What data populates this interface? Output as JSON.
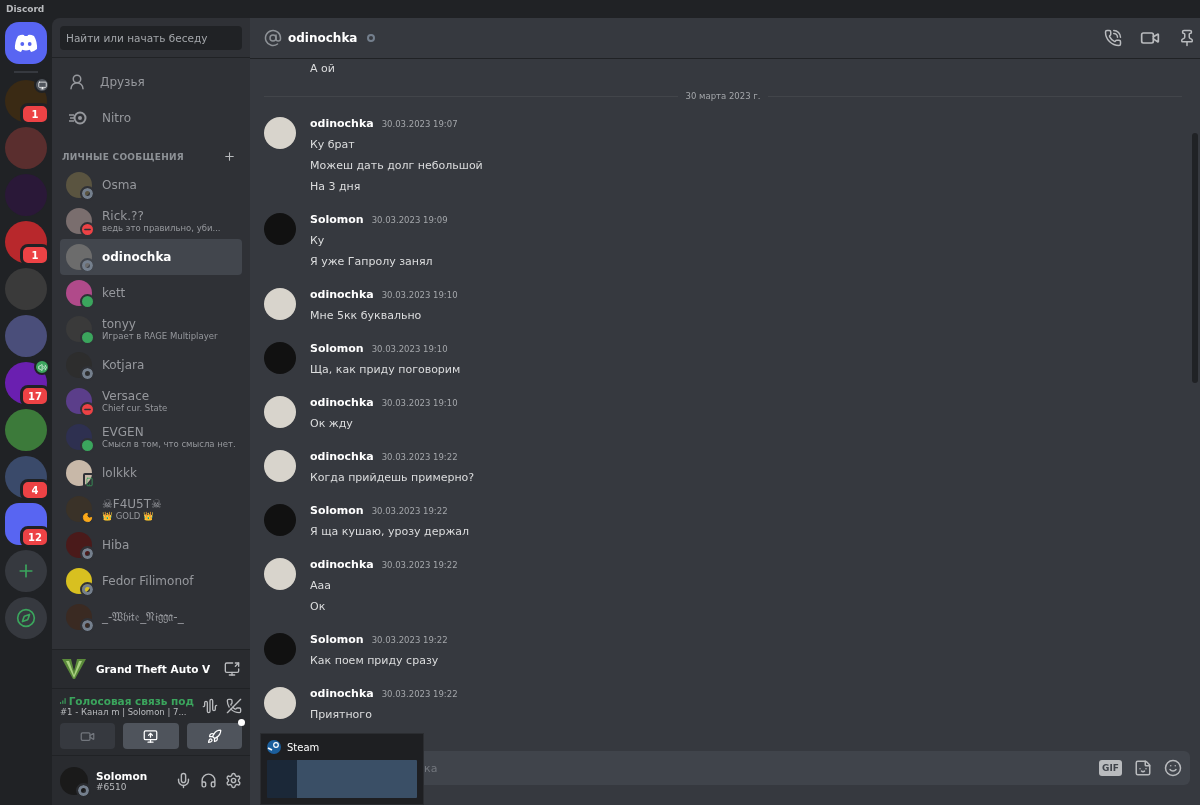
{
  "app_title": "Discord",
  "servers": [
    {
      "kind": "screen",
      "color": "#3a2a14",
      "badge": "1"
    },
    {
      "kind": "plain",
      "color": "#5a2e2e"
    },
    {
      "kind": "plain",
      "color": "#2a1838"
    },
    {
      "kind": "plain",
      "color": "#b8282c",
      "badge": "1"
    },
    {
      "kind": "plain",
      "color": "#3a3a3a"
    },
    {
      "kind": "plain",
      "color": "#4a4e7a"
    },
    {
      "kind": "speaker",
      "color": "#6a1fb0",
      "badge": "17"
    },
    {
      "kind": "plain",
      "color": "#3c7a3a"
    },
    {
      "kind": "plain",
      "color": "#3a4a6a",
      "badge": "4"
    },
    {
      "kind": "plain",
      "color": "#5865f2",
      "badge": "12"
    }
  ],
  "search": {
    "placeholder": "Найти или начать беседу"
  },
  "nav": [
    {
      "kind": "friends",
      "label": "Друзья"
    },
    {
      "kind": "nitro",
      "label": "Nitro"
    }
  ],
  "dm_header": "ЛИЧНЫЕ СООБЩЕНИЯ",
  "dms": [
    {
      "kind": "offline",
      "name": "Osma",
      "selected": false
    },
    {
      "kind": "dnd",
      "name": "Rick.??",
      "subtitle": "ведь это правильно, уби...",
      "selected": false
    },
    {
      "kind": "offline",
      "name": "odinochka",
      "selected": true
    },
    {
      "kind": "online",
      "name": "kett",
      "selected": false
    },
    {
      "kind": "online",
      "name": "tonyy",
      "subtitle": "Играет в RAGE Multiplayer",
      "selected": false
    },
    {
      "kind": "offline",
      "name": "Kotjara",
      "selected": false
    },
    {
      "kind": "dnd",
      "name": "Versace",
      "subtitle": "Chief cur. State",
      "selected": false
    },
    {
      "kind": "online",
      "name": "EVGEN",
      "subtitle": "Смысл в том, что смысла нет.",
      "selected": false
    },
    {
      "kind": "mobile",
      "name": "lolkkk",
      "selected": false
    },
    {
      "kind": "idle",
      "name": "☠F4U5T☠",
      "subtitle": "👑 GOLD 👑",
      "selected": false
    },
    {
      "kind": "offline",
      "name": "Hiba",
      "selected": false
    },
    {
      "kind": "offline",
      "name": "Fedor Filimonof",
      "selected": false
    },
    {
      "kind": "offline",
      "name": "_-𝔚𝔥𝔦𝔱𝔢_𝔑𝔦𝔤𝔤𝔞-_",
      "selected": false
    }
  ],
  "activity": {
    "game": "Grand Theft Auto V"
  },
  "voice": {
    "status": "Голосовая связь под",
    "channel": "#1 - Канал m | Solomon | 7..."
  },
  "user": {
    "name": "Solomon",
    "tag": "#6510"
  },
  "chat_header": {
    "name": "odinochka"
  },
  "messages": [
    {
      "lines": [
        "А ой"
      ]
    },
    {
      "kind": "divider",
      "label": "30 марта 2023 г."
    },
    {
      "author": "odinochka",
      "time": "30.03.2023 19:07",
      "lines": [
        "Ку брат",
        "Можеш дать долг небольшой",
        "На 3 дня"
      ]
    },
    {
      "author": "Solomon",
      "time": "30.03.2023 19:09",
      "lines": [
        "Ку",
        "Я уже Гапролу занял"
      ]
    },
    {
      "author": "odinochka",
      "time": "30.03.2023 19:10",
      "lines": [
        "Мне 5кк буквально"
      ]
    },
    {
      "author": "Solomon",
      "time": "30.03.2023 19:10",
      "lines": [
        "Ща, как приду поговорим"
      ]
    },
    {
      "author": "odinochka",
      "time": "30.03.2023 19:10",
      "lines": [
        "Ок жду"
      ]
    },
    {
      "author": "odinochka",
      "time": "30.03.2023 19:22",
      "lines": [
        "Когда прийдешь примерно?"
      ]
    },
    {
      "author": "Solomon",
      "time": "30.03.2023 19:22",
      "lines": [
        "Я ща кушаю, урозу держал"
      ]
    },
    {
      "author": "odinochka",
      "time": "30.03.2023 19:22",
      "lines": [
        "Ааа",
        "Ок"
      ]
    },
    {
      "author": "Solomon",
      "time": "30.03.2023 19:22",
      "lines": [
        "Как поем приду сразу"
      ]
    },
    {
      "author": "odinochka",
      "time": "30.03.2023 19:22",
      "lines": [
        "Приятного"
      ]
    }
  ],
  "composer": {
    "placeholder": "ка",
    "gif_label": "GIF"
  },
  "popup": {
    "title": "Steam"
  }
}
